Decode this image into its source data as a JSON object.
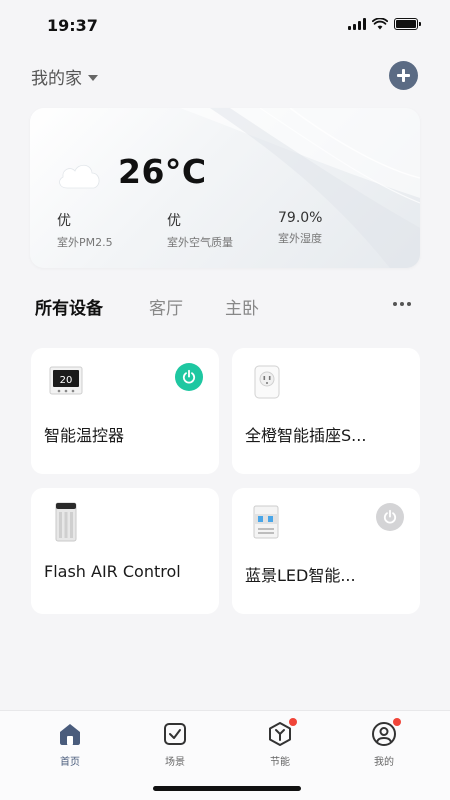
{
  "status_bar": {
    "time": "19:37"
  },
  "header": {
    "home_name": "我的家"
  },
  "weather": {
    "temperature": "26°C",
    "metrics": [
      {
        "value": "优",
        "label": "室外PM2.5"
      },
      {
        "value": "优",
        "label": "室外空气质量"
      },
      {
        "value": "79.0%",
        "label": "室外湿度"
      }
    ]
  },
  "tabs": [
    {
      "label": "所有设备",
      "active": true
    },
    {
      "label": "客厅",
      "active": false
    },
    {
      "label": "主卧",
      "active": false
    }
  ],
  "devices": [
    {
      "name": "智能温控器",
      "icon": "thermostat-icon",
      "power": "on"
    },
    {
      "name": "全橙智能插座S...",
      "icon": "smart-plug-icon",
      "power": null
    },
    {
      "name": "Flash AIR Control",
      "icon": "air-purifier-icon",
      "power": null
    },
    {
      "name": "蓝景LED智能...",
      "icon": "led-controller-icon",
      "power": "off"
    }
  ],
  "bottom_nav": [
    {
      "label": "首页",
      "icon": "home-icon",
      "active": true
    },
    {
      "label": "场景",
      "icon": "scene-icon",
      "active": false
    },
    {
      "label": "节能",
      "icon": "energy-icon",
      "active": false,
      "badge": true
    },
    {
      "label": "我的",
      "icon": "profile-icon",
      "active": false,
      "badge": true
    }
  ],
  "colors": {
    "accent": "#5b6b84",
    "power_on": "#1ec7a1",
    "power_off": "#d4d4d6",
    "badge": "#f04438"
  }
}
